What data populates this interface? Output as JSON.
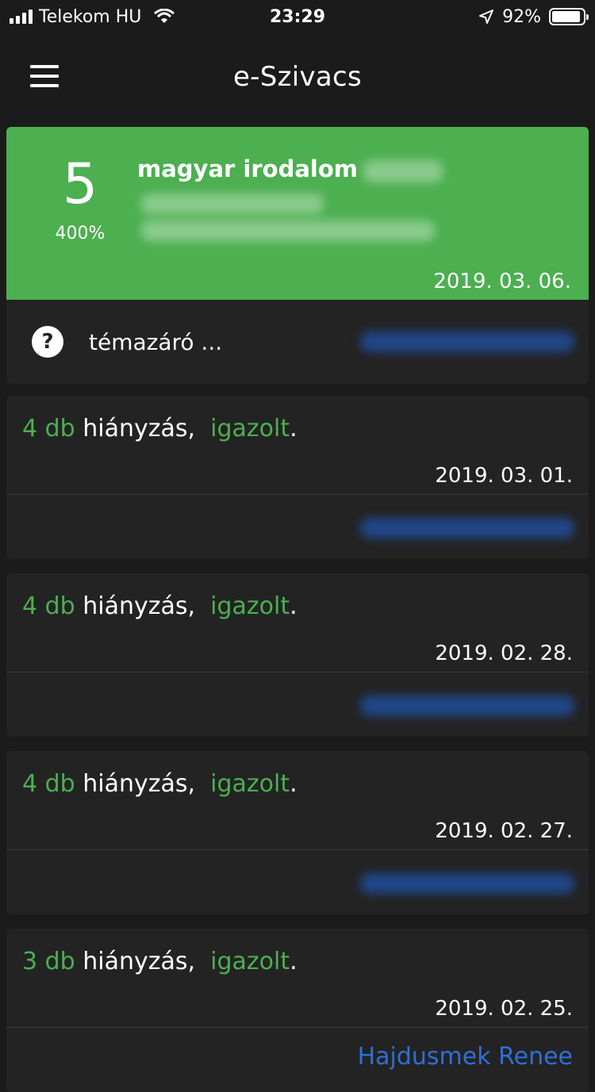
{
  "status_bar": {
    "carrier": "Telekom HU",
    "time": "23:29",
    "battery": "92%",
    "battery_level": 0.92
  },
  "header": {
    "title": "e-Szivacs"
  },
  "grade": {
    "value": "5",
    "percent": "400%",
    "subject": "magyar irodalom",
    "date": "2019. 03. 06."
  },
  "theme": {
    "text": "témazáró ..."
  },
  "absences": [
    {
      "count": "4 db",
      "label": "hiányzás,",
      "status": "igazolt",
      "date": "2019. 03. 01."
    },
    {
      "count": "4 db",
      "label": "hiányzás,",
      "status": "igazolt",
      "date": "2019. 02. 28."
    },
    {
      "count": "4 db",
      "label": "hiányzás,",
      "status": "igazolt",
      "date": "2019. 02. 27."
    },
    {
      "count": "3 db",
      "label": "hiányzás,",
      "status": "igazolt",
      "date": "2019. 02. 25.",
      "teacher": "Hajdusmek Renee"
    }
  ],
  "colors": {
    "background": "#1b1b1b",
    "card": "#232323",
    "accent_green": "#4caf50",
    "link_blue": "#2f6fd6"
  },
  "icons": {
    "menu": "hamburger-menu-icon",
    "help": "question-circle-icon",
    "wifi": "wifi-icon",
    "location": "location-arrow-icon",
    "battery": "battery-icon",
    "signal": "signal-bars-icon"
  }
}
